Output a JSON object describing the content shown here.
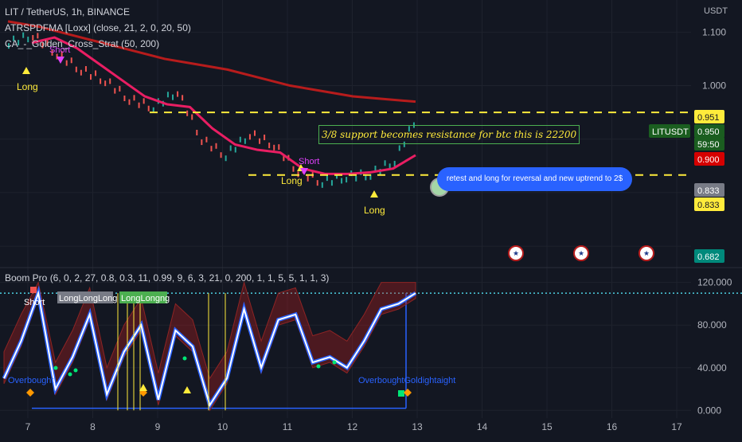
{
  "header": {
    "symbol_line": "LIT / TetherUS, 1h, BINANCE",
    "indicator_1": "ATRSPDFMA [Loxx] (close, 21, 2, 0, 20, 50)",
    "indicator_2": "CA_-_Golden_Cross_Strat (50, 200)",
    "currency": "USDT"
  },
  "annotations": {
    "resistance_note": "3/8 support becomes resistance for btc this is 22200",
    "callout": "retest and long for reversal and new uptrend to 2$"
  },
  "signal_labels": {
    "long": "Long",
    "short": "Short"
  },
  "price_axis": {
    "labels": [
      "1.100",
      "1.000"
    ],
    "badges": {
      "p0951": "0.951",
      "p0950": "0.950",
      "countdown": "59:50",
      "p0900": "0.900",
      "p0833a": "0.833",
      "p0833b": "0.833",
      "p0682": "0.682",
      "symbol": "LITUSDT"
    }
  },
  "oscillator": {
    "title": "Boom Pro (6, 0, 2, 27, 0.8, 0.3, 11, 0.99, 9, 6, 3, 21, 0, 200, 1, 1, 5, 5, 1, 1, 3)",
    "axis_labels": [
      "120.000",
      "80.000",
      "40.000",
      "0.000"
    ],
    "text_labels": {
      "short": "Short",
      "long_group_a": "LongLongLong",
      "long_group_b": "LongLongng",
      "overbought_a": "Overbought",
      "overbought_b": "OverboughtGoldightaight"
    }
  },
  "time_axis": {
    "labels": [
      "7",
      "8",
      "9",
      "10",
      "11",
      "12",
      "13",
      "14",
      "15",
      "16",
      "17"
    ]
  },
  "chart_data": [
    {
      "type": "line",
      "title": "LIT / TetherUS, 1h, BINANCE",
      "x": [
        "7",
        "8",
        "9",
        "10",
        "11",
        "12",
        "13"
      ],
      "series": [
        {
          "name": "LIT / TetherUS",
          "values": [
            1.08,
            1.095,
            1.06,
            1.03,
            1.01,
            0.975,
            0.96,
            0.99,
            0.9,
            0.87,
            0.91,
            0.89,
            0.84,
            0.82,
            0.83,
            0.835,
            0.86,
            0.95
          ]
        },
        {
          "name": "ATRSPDFMA",
          "values": [
            1.08,
            1.09,
            1.07,
            1.04,
            1.01,
            0.98,
            0.965,
            0.96,
            0.92,
            0.89,
            0.88,
            0.875,
            0.845,
            0.835,
            0.835,
            0.838,
            0.845,
            0.87
          ]
        },
        {
          "name": "Golden Cross MA200",
          "values": [
            1.12,
            1.11,
            1.095,
            1.08,
            1.065,
            1.05,
            1.04,
            1.03,
            1.015,
            1.0,
            0.99,
            0.98,
            0.975,
            0.97
          ]
        }
      ],
      "levels": [
        0.95,
        0.833
      ],
      "ylim": [
        0.66,
        1.16
      ]
    },
    {
      "type": "line",
      "title": "Boom Pro",
      "x": [
        "7",
        "8",
        "9",
        "10",
        "11",
        "12",
        "13"
      ],
      "series": [
        {
          "name": "Boom Pro",
          "values": [
            30,
            65,
            110,
            20,
            50,
            90,
            15,
            55,
            80,
            10,
            75,
            60,
            5,
            30,
            95,
            40,
            85,
            90,
            45,
            50,
            40,
            65,
            95,
            100,
            110
          ]
        }
      ],
      "ylim": [
        -5,
        122
      ]
    }
  ]
}
